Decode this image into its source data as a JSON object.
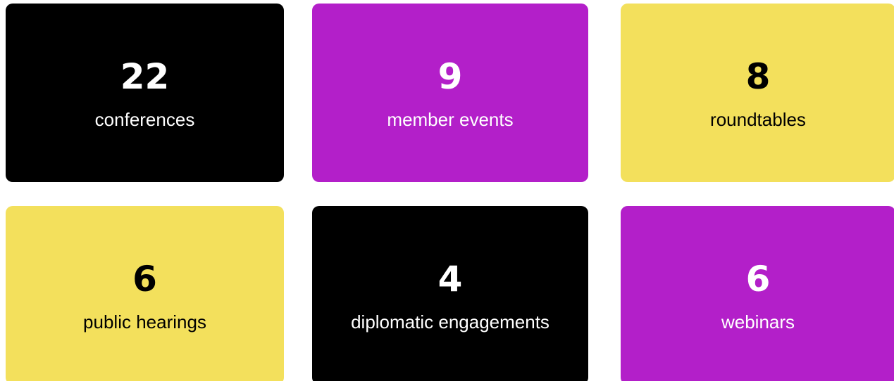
{
  "stats": [
    {
      "value": "22",
      "label": "conferences",
      "color": "#000000"
    },
    {
      "value": "9",
      "label": "member events",
      "color": "#b31fc9"
    },
    {
      "value": "8",
      "label": "roundtables",
      "color": "#f3e05c"
    },
    {
      "value": "6",
      "label": "public hearings",
      "color": "#f3e05c"
    },
    {
      "value": "4",
      "label": "diplomatic engagements",
      "color": "#000000"
    },
    {
      "value": "6",
      "label": "webinars",
      "color": "#b31fc9"
    }
  ]
}
